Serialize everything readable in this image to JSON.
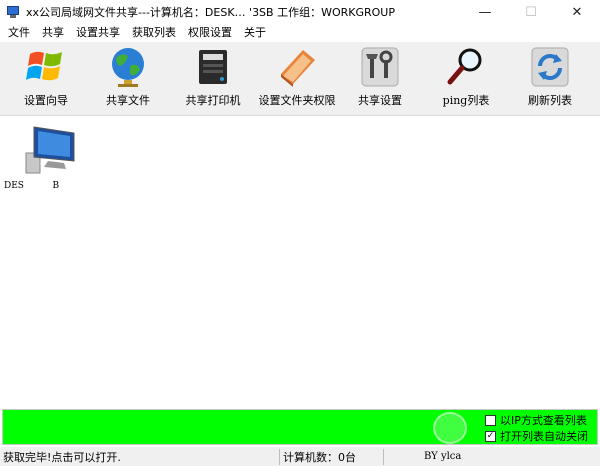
{
  "window": {
    "title": "xx公司局域网文件共享---计算机名：DESK… '3SB  工作组：WORKGROUP",
    "minimize_glyph": "—",
    "maximize_glyph": "☐",
    "close_glyph": "✕"
  },
  "menu": {
    "items": [
      "文件",
      "共享",
      "设置共享",
      "获取列表",
      "权限设置",
      "关于"
    ]
  },
  "toolbar": {
    "items": [
      {
        "label": "设置向导",
        "icon": "windows-logo-icon"
      },
      {
        "label": "共享文件",
        "icon": "globe-icon"
      },
      {
        "label": "共享打印机",
        "icon": "printer-icon"
      },
      {
        "label": "设置文件夹权限",
        "icon": "notebook-icon"
      },
      {
        "label": "共享设置",
        "icon": "tools-icon"
      },
      {
        "label": "ping列表",
        "icon": "magnifier-icon"
      },
      {
        "label": "刷新列表",
        "icon": "refresh-icon"
      }
    ]
  },
  "computers": [
    {
      "name": "DES          B",
      "icon": "computer-icon"
    }
  ],
  "progress": {
    "value": 1.0,
    "color": "#00ff00"
  },
  "options": [
    {
      "label": "以IP方式查看列表",
      "checked": false,
      "mark": ""
    },
    {
      "label": "打开列表自动关闭",
      "checked": true,
      "mark": "✓"
    }
  ],
  "status": {
    "message": "获取完毕!点击可以打开.",
    "count_text": "计算机数：0台",
    "author": "BY ylca"
  }
}
